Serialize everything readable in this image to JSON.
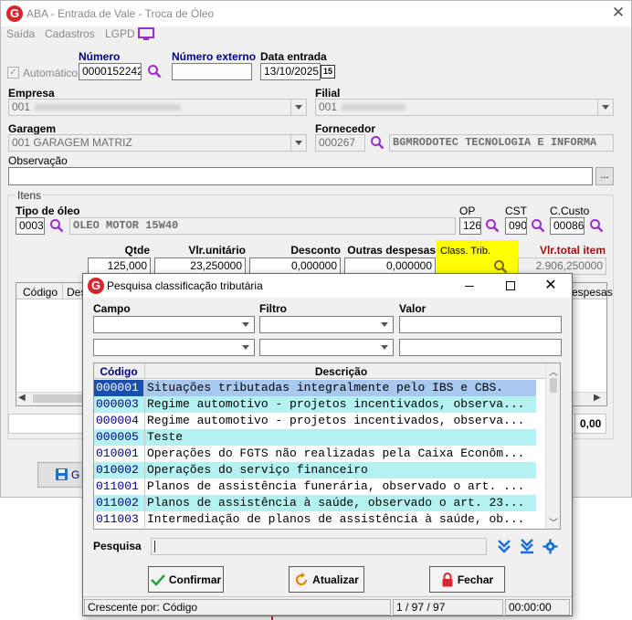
{
  "window": {
    "title": "ABA - Entrada de Vale - Troca de Óleo",
    "logo_letter": "G"
  },
  "menu": [
    "Saída",
    "Cadastros",
    "LGPD"
  ],
  "form": {
    "automatico_label": "Automático",
    "numero_label": "Número",
    "numero_value": "0000152242",
    "numero_externo_label": "Número externo",
    "numero_externo_value": "",
    "data_entrada_label": "Data entrada",
    "data_entrada_value": "13/10/2025",
    "calendar_day": "15",
    "empresa_label": "Empresa",
    "empresa_value": "001",
    "filial_label": "Filial",
    "filial_value": "001",
    "garagem_label": "Garagem",
    "garagem_value": "001 GARAGEM MATRIZ",
    "fornecedor_label": "Fornecedor",
    "fornecedor_code": "000267",
    "fornecedor_name": "BGMRODOTEC TECNOLOGIA E INFORMA",
    "observacao_label": "Observação",
    "observacao_value": "",
    "ellipsis": "..."
  },
  "itens": {
    "group_title": "Itens",
    "tipo_oleo_label": "Tipo de óleo",
    "tipo_oleo_code": "0003",
    "tipo_oleo_name": "OLEO MOTOR 15W40",
    "op_label": "OP",
    "op_value": "126",
    "cst_label": "CST",
    "cst_value": "090",
    "ccusto_label": "C.Custo",
    "ccusto_value": "00086",
    "qtde_label": "Qtde",
    "qtde_value": "125,000",
    "vlr_unitario_label": "Vlr.unitário",
    "vlr_unitario_value": "23,250000",
    "desconto_label": "Desconto",
    "desconto_value": "0,000000",
    "outras_despesas_label": "Outras despesas",
    "outras_despesas_value": "0,000000",
    "class_trib_label": "Class. Trib.",
    "class_trib_value": "",
    "vlr_total_label": "Vlr.total item",
    "vlr_total_value": "2.906,250000",
    "col_codigo": "Código",
    "col_des": "Des",
    "col_despesas": "espesas",
    "total_value": "0,00",
    "save_partial": "G"
  },
  "dialog": {
    "title": "Pesquisa classificação tributária",
    "campo_label": "Campo",
    "filtro_label": "Filtro",
    "valor_label": "Valor",
    "col_codigo": "Código",
    "col_descricao": "Descrição",
    "rows": [
      {
        "code": "000001",
        "desc": "Situações tributadas integralmente pelo IBS e CBS."
      },
      {
        "code": "000003",
        "desc": "Regime automotivo - projetos incentivados, observa..."
      },
      {
        "code": "000004",
        "desc": "Regime automotivo - projetos incentivados, observa..."
      },
      {
        "code": "000005",
        "desc": "Teste"
      },
      {
        "code": "010001",
        "desc": "Operações do FGTS não realizadas pela Caixa Econôm..."
      },
      {
        "code": "010002",
        "desc": "Operações do serviço financeiro"
      },
      {
        "code": "011001",
        "desc": "Planos de assistência funerária, observado o art. ..."
      },
      {
        "code": "011002",
        "desc": "Planos de assistência à saúde, observado o art. 23..."
      },
      {
        "code": "011003",
        "desc": "Intermediação de planos de assistência à saúde, ob..."
      }
    ],
    "pesquisa_label": "Pesquisa",
    "confirmar_label": "Confirmar",
    "atualizar_label": "Atualizar",
    "fechar_label": "Fechar",
    "status_order": "Crescente por: Código",
    "status_count": "1 / 97 / 97",
    "status_time": "00:00:00"
  },
  "colors": {
    "row_selected": "#a8c8f0",
    "row_alt": "#b4f2f2",
    "row_plain": "#ffffff",
    "highlight": "#ffff00",
    "logo_red": "#d8262e",
    "icon_blue": "#1a6fd4"
  }
}
